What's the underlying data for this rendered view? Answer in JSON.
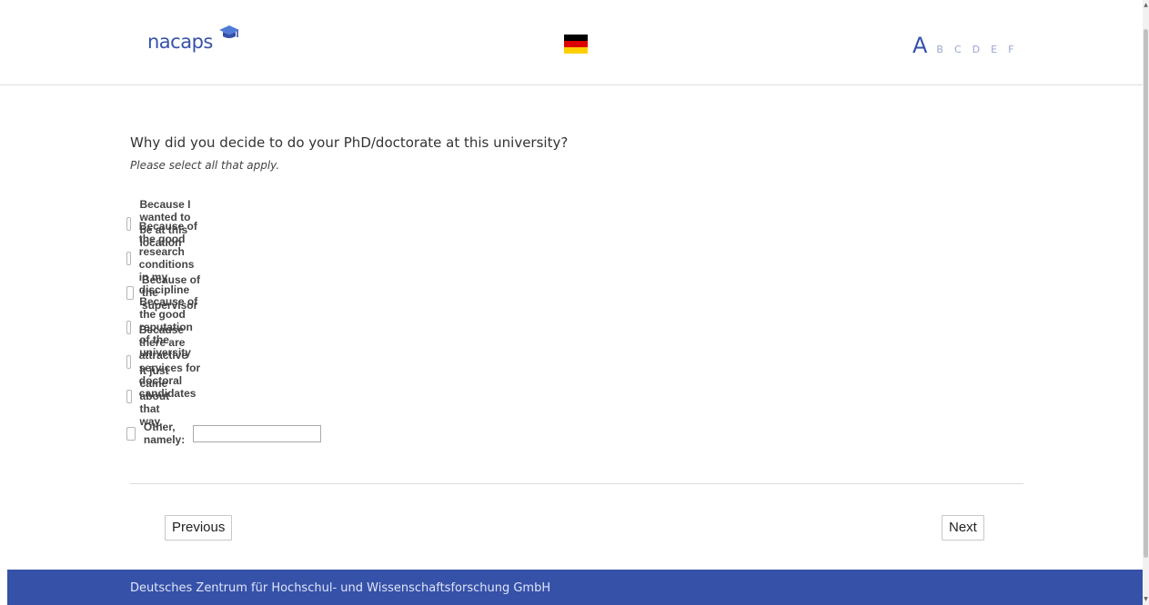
{
  "header": {
    "logo_text": "nacaps",
    "logo_icon": "graduation-cap-icon",
    "language_flag": "flag-germany-icon",
    "flag_colors": [
      "#000000",
      "#dd0000",
      "#ffce00"
    ],
    "progress": {
      "active": "A",
      "steps": [
        "B",
        "C",
        "D",
        "E",
        "F"
      ]
    }
  },
  "question": {
    "text": "Why did you decide to do your PhD/doctorate at this university?",
    "hint": "Please select all that apply."
  },
  "options": [
    {
      "label": "Because I wanted to be at this location",
      "checked": false
    },
    {
      "label": "Because of the good research conditions in my discipline",
      "checked": false
    },
    {
      "label": "Because of the supervisor",
      "checked": false
    },
    {
      "label": "Because of the good reputation of the university",
      "checked": false
    },
    {
      "label": "Because there are attractive services for doctoral candidates",
      "checked": false
    },
    {
      "label": "It just came about that way.",
      "checked": false
    },
    {
      "label": "Other, namely:",
      "checked": false,
      "input_value": ""
    }
  ],
  "navigation": {
    "previous_label": "Previous",
    "next_label": "Next"
  },
  "footer": {
    "text": "Deutsches Zentrum für Hochschul- und Wissenschaftsforschung GmbH"
  },
  "colors": {
    "brand": "#3651a8",
    "progress_inactive": "#9aa6cf"
  }
}
